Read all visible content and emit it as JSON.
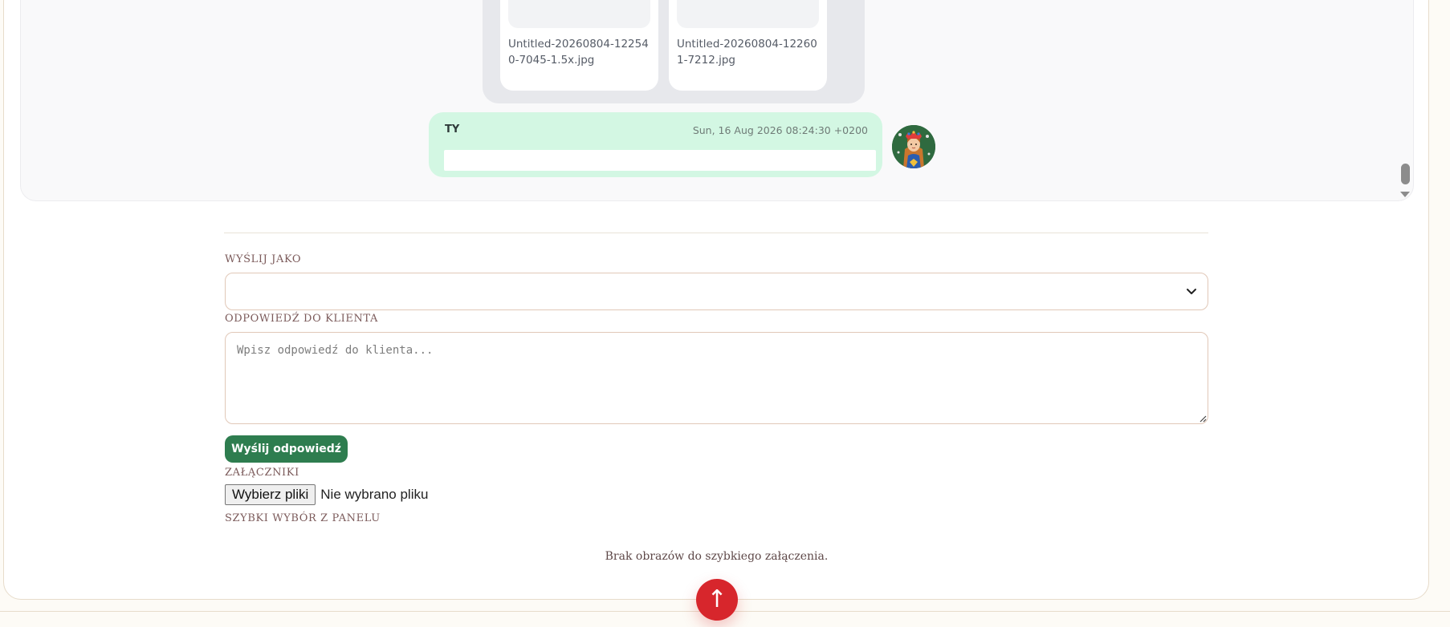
{
  "chat": {
    "attachments": [
      {
        "filename": "Untitled-20260804-122540-7045-1.5x.jpg"
      },
      {
        "filename": "Untitled-20260804-122601-7212.jpg"
      }
    ],
    "message": {
      "author": "TY",
      "timestamp": "Sun, 16 Aug 2026 08:24:30 +0200",
      "body": ""
    },
    "avatar_icon": "avatar-portrait"
  },
  "form": {
    "send_as_label": "WYŚLIJ JAKO",
    "send_as_value": "",
    "reply_label": "ODPOWIEDŹ DO KLIENTA",
    "reply_placeholder": "Wpisz odpowiedź do klienta...",
    "send_button": "Wyślij odpowiedź",
    "attachments_label": "ZAŁĄCZNIKI",
    "file_button": "Wybierz pliki",
    "file_status": "Nie wybrano pliku",
    "quick_pick_label": "SZYBKI WYBÓR Z PANELU",
    "quick_pick_empty": "Brak obrazów do szybkiego załączenia."
  },
  "scroll_top": {
    "icon": "arrow-up-icon",
    "glyph": "↑"
  },
  "colors": {
    "accent_green": "#2e7d4f",
    "bubble_green": "#d3f7e3",
    "scroll_top_red": "#d7262c",
    "label_brown": "#7b5a5a"
  }
}
